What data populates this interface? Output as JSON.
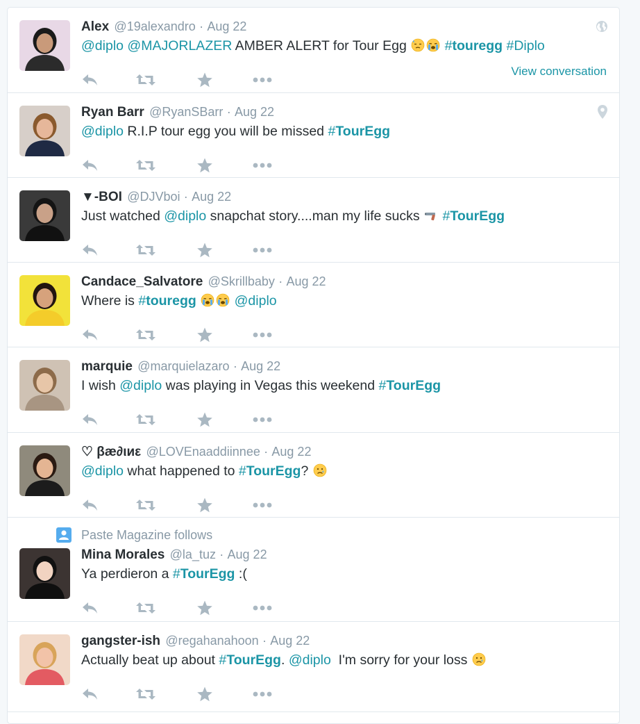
{
  "colors": {
    "link": "#1b95a6",
    "muted": "#8899a6",
    "action_icon": "#aab8c2",
    "text": "#292f33"
  },
  "tweets": [
    {
      "fullname": "Alex",
      "username": "@19alexandro",
      "time": "Aug 22",
      "corner_icon": "globe-icon",
      "parts": [
        {
          "t": "link",
          "v": "@diplo"
        },
        {
          "t": "text",
          "v": " "
        },
        {
          "t": "link",
          "v": "@MAJORLAZER"
        },
        {
          "t": "text",
          "v": " AMBER ALERT for Tour Egg "
        },
        {
          "t": "emoji",
          "v": "downcast-sweat-emoji"
        },
        {
          "t": "emoji",
          "v": "loudly-crying-emoji"
        },
        {
          "t": "text",
          "v": " "
        },
        {
          "t": "hashtag",
          "v": "touregg"
        },
        {
          "t": "text",
          "v": " "
        },
        {
          "t": "link",
          "v": "#Diplo"
        }
      ],
      "view_conversation": "View conversation"
    },
    {
      "fullname": "Ryan Barr",
      "username": "@RyanSBarr",
      "time": "Aug 22",
      "corner_icon": "location-pin-icon",
      "parts": [
        {
          "t": "link",
          "v": "@diplo"
        },
        {
          "t": "text",
          "v": " R.I.P tour egg you will be missed "
        },
        {
          "t": "hashtag",
          "v": "TourEgg"
        }
      ]
    },
    {
      "fullname": "▼-BOI",
      "username": "@DJVboi",
      "time": "Aug 22",
      "parts": [
        {
          "t": "text",
          "v": "Just watched "
        },
        {
          "t": "link",
          "v": "@diplo"
        },
        {
          "t": "text",
          "v": " snapchat story....man my life sucks "
        },
        {
          "t": "emoji",
          "v": "pistol-emoji"
        },
        {
          "t": "text",
          "v": " "
        },
        {
          "t": "hashtag",
          "v": "TourEgg"
        }
      ]
    },
    {
      "fullname": "Candace_Salvatore",
      "username": "@Skrillbaby",
      "time": "Aug 22",
      "parts": [
        {
          "t": "text",
          "v": "Where is "
        },
        {
          "t": "hashtag",
          "v": "touregg"
        },
        {
          "t": "text",
          "v": " "
        },
        {
          "t": "emoji",
          "v": "loudly-crying-emoji"
        },
        {
          "t": "emoji",
          "v": "loudly-crying-emoji"
        },
        {
          "t": "text",
          "v": " "
        },
        {
          "t": "link",
          "v": "@diplo"
        }
      ]
    },
    {
      "fullname": "marquie",
      "username": "@marquielazaro",
      "time": "Aug 22",
      "parts": [
        {
          "t": "text",
          "v": "I wish "
        },
        {
          "t": "link",
          "v": "@diplo"
        },
        {
          "t": "text",
          "v": " was playing in Vegas this weekend "
        },
        {
          "t": "hashtag",
          "v": "TourEgg"
        }
      ]
    },
    {
      "fullname": "♡ βæ∂ιиε",
      "username": "@LOVEnaaddiinnee",
      "time": "Aug 22",
      "parts": [
        {
          "t": "link",
          "v": "@diplo"
        },
        {
          "t": "text",
          "v": " what happened to "
        },
        {
          "t": "hashtag",
          "v": "TourEgg"
        },
        {
          "t": "text",
          "v": "? "
        },
        {
          "t": "emoji",
          "v": "crying-face-emoji"
        }
      ]
    },
    {
      "context": "Paste Magazine follows",
      "fullname": "Mina Morales",
      "username": "@la_tuz",
      "time": "Aug 22",
      "parts": [
        {
          "t": "text",
          "v": "Ya perdieron a "
        },
        {
          "t": "hashtag",
          "v": "TourEgg"
        },
        {
          "t": "text",
          "v": " :("
        }
      ]
    },
    {
      "fullname": "gangster-ish",
      "username": "@regahanahoon",
      "time": "Aug 22",
      "parts": [
        {
          "t": "text",
          "v": "Actually beat up about "
        },
        {
          "t": "hashtag",
          "v": "TourEgg"
        },
        {
          "t": "text",
          "v": ". "
        },
        {
          "t": "link",
          "v": "@diplo"
        },
        {
          "t": "text",
          "v": "  I'm sorry for your loss "
        },
        {
          "t": "emoji",
          "v": "crying-face-emoji"
        }
      ]
    }
  ],
  "separator": "·"
}
